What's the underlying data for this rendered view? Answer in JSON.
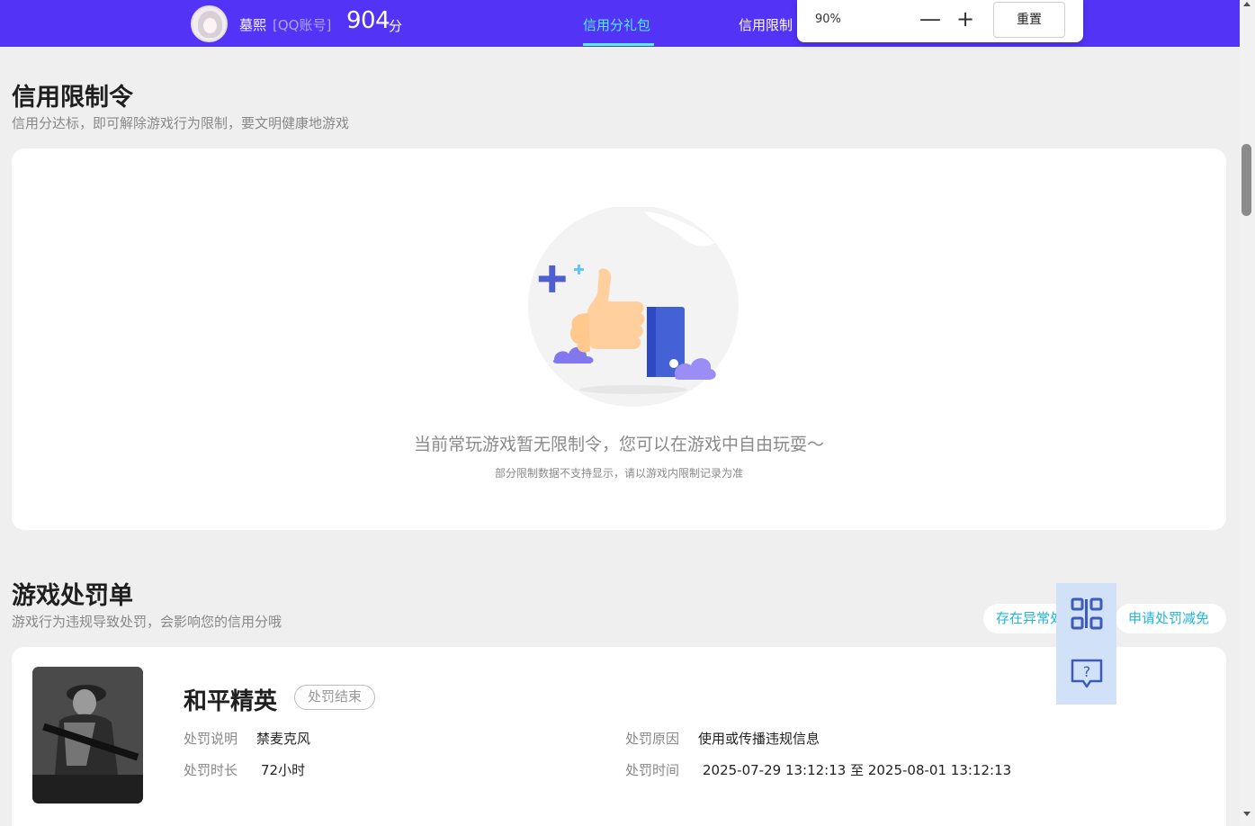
{
  "header": {
    "username": "墓熙",
    "account_type": "[QQ账号]",
    "score": "904",
    "score_unit": "分",
    "tabs": [
      {
        "label": "信用分礼包",
        "active": true
      },
      {
        "label": "信用限制",
        "active": false
      }
    ],
    "accent_color": "#5333f5",
    "active_tab_color": "#4ff3ff"
  },
  "zoom": {
    "level": "90%",
    "minus_symbol": "—",
    "plus_symbol": "+",
    "reset_label": "重置"
  },
  "restrictions": {
    "title": "信用限制令",
    "subtitle": "信用分达标，即可解除游戏行为限制，要文明健康地游戏",
    "empty_message": "当前常玩游戏暂无限制令，您可以在游戏中自由玩耍～",
    "empty_note": "部分限制数据不支持显示，请以游戏内限制记录为准"
  },
  "penalties": {
    "title": "游戏处罚单",
    "subtitle": "游戏行为违规导致处罚，会影响您的信用分哦",
    "abnormal_button": "存在异常处罚",
    "appeal_button": "申请处罚减免",
    "records": [
      {
        "game": "和平精英",
        "status": "处罚结束",
        "desc_label": "处罚说明",
        "desc_value": "禁麦克风",
        "duration_label": "处罚时长",
        "duration_value": "72小时",
        "reason_label": "处罚原因",
        "reason_value": "使用或传播违规信息",
        "time_label": "处罚时间",
        "time_value": "2025-07-29 13:12:13 至 2025-08-01 13:12:13"
      }
    ]
  },
  "floating_tools": [
    {
      "icon": "qr-code-icon"
    },
    {
      "icon": "help-chat-icon"
    }
  ]
}
